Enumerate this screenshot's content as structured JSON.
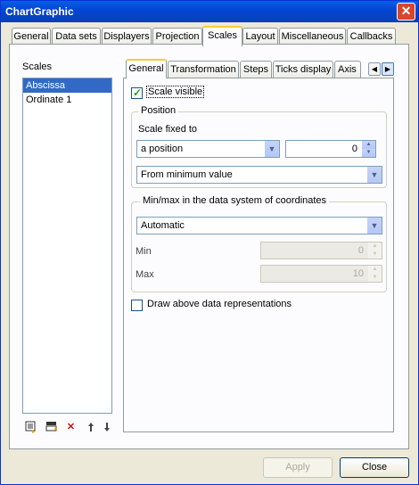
{
  "window": {
    "title": "ChartGraphic",
    "close_glyph": "✕"
  },
  "tabs": [
    "General",
    "Data sets",
    "Displayers",
    "Projection",
    "Scales",
    "Layout",
    "Miscellaneous",
    "Callbacks"
  ],
  "scales_label": "Scales",
  "scales_list": [
    "Abscissa",
    "Ordinate 1"
  ],
  "toolbar_icons": [
    "new-scale-icon",
    "insert-scale-icon",
    "delete-icon",
    "move-up-icon",
    "move-down-icon"
  ],
  "subtabs": [
    "General",
    "Transformation",
    "Steps",
    "Ticks display",
    "Axis"
  ],
  "scale_visible": {
    "label": "Scale visible",
    "checked": true
  },
  "position_group": {
    "title": "Position",
    "fixed_label": "Scale fixed to",
    "fixed_value": "a position",
    "position_value": "0",
    "mode_value": "From minimum value"
  },
  "minmax_group": {
    "title": "Min/max in the data system of coordinates",
    "mode_value": "Automatic",
    "min_label": "Min",
    "min_value": "0",
    "max_label": "Max",
    "max_value": "10"
  },
  "draw_above": {
    "label": "Draw above data representations",
    "checked": false
  },
  "buttons": {
    "apply": "Apply",
    "close": "Close"
  }
}
